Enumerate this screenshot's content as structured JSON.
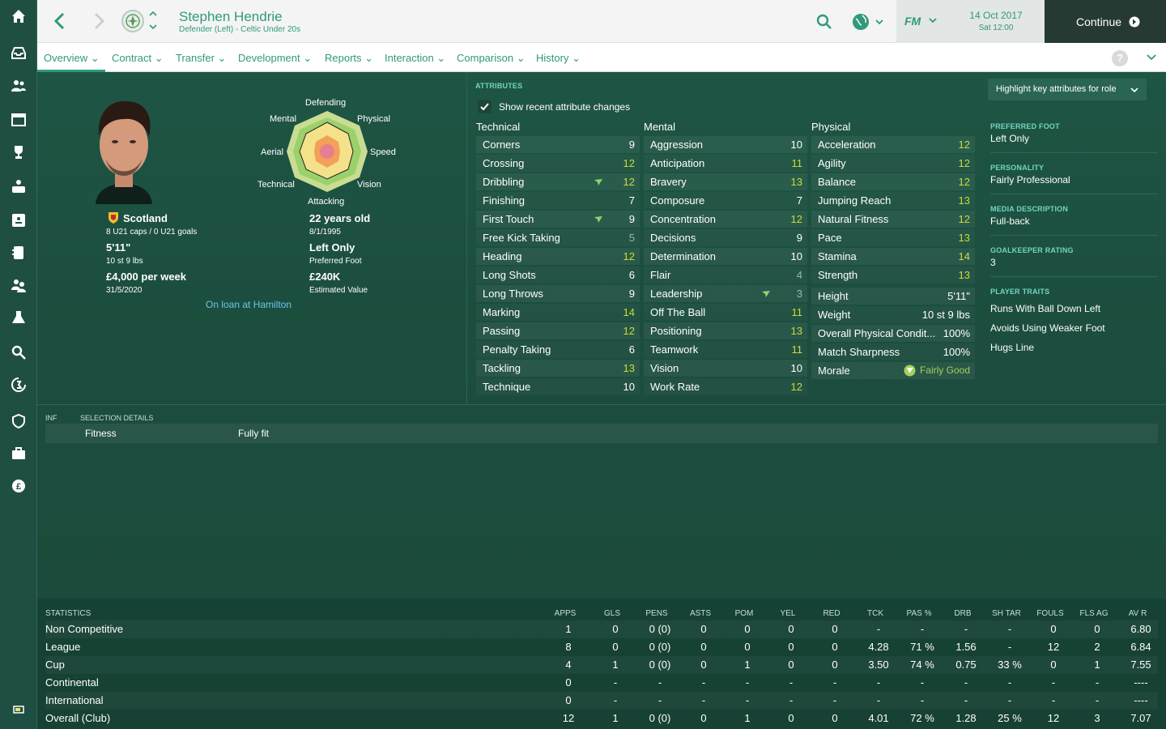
{
  "player": {
    "name": "Stephen Hendrie",
    "subtitle": "Defender (Left) - Celtic Under 20s"
  },
  "header": {
    "date": "14 Oct 2017",
    "time": "Sat 12:00",
    "fm_label": "FM",
    "continue_label": "Continue"
  },
  "tabs": [
    "Overview",
    "Contract",
    "Transfer",
    "Development",
    "Reports",
    "Interaction",
    "Comparison",
    "History"
  ],
  "radar": {
    "top": "Defending",
    "mental": "Mental",
    "physical": "Physical",
    "aerial": "Aerial",
    "speed": "Speed",
    "technical": "Technical",
    "vision": "Vision",
    "attacking": "Attacking"
  },
  "bio": {
    "nation": "Scotland",
    "caps": "8 U21 caps / 0 U21 goals",
    "height": "5'11\"",
    "weight": "10 st 9 lbs",
    "wage": "£4,000 per week",
    "contract_end": "31/5/2020",
    "age": "22 years old",
    "dob": "8/1/1995",
    "foot": "Left Only",
    "foot_label": "Preferred Foot",
    "value": "£240K",
    "value_label": "Estimated Value",
    "loan": "On loan at Hamilton"
  },
  "attributes": {
    "section_label": "ATTRIBUTES",
    "show_changes": "Show recent attribute changes",
    "highlight_dropdown": "Highlight key attributes for role",
    "technical_label": "Technical",
    "mental_label": "Mental",
    "physical_label": "Physical",
    "technical": [
      {
        "name": "Corners",
        "value": "9"
      },
      {
        "name": "Crossing",
        "value": "12"
      },
      {
        "name": "Dribbling",
        "value": "12"
      },
      {
        "name": "Finishing",
        "value": "7"
      },
      {
        "name": "First Touch",
        "value": "9"
      },
      {
        "name": "Free Kick Taking",
        "value": "5"
      },
      {
        "name": "Heading",
        "value": "12"
      },
      {
        "name": "Long Shots",
        "value": "6"
      },
      {
        "name": "Long Throws",
        "value": "9"
      },
      {
        "name": "Marking",
        "value": "14"
      },
      {
        "name": "Passing",
        "value": "12"
      },
      {
        "name": "Penalty Taking",
        "value": "6"
      },
      {
        "name": "Tackling",
        "value": "13"
      },
      {
        "name": "Technique",
        "value": "10"
      }
    ],
    "mental": [
      {
        "name": "Aggression",
        "value": "10"
      },
      {
        "name": "Anticipation",
        "value": "11"
      },
      {
        "name": "Bravery",
        "value": "13"
      },
      {
        "name": "Composure",
        "value": "7"
      },
      {
        "name": "Concentration",
        "value": "12"
      },
      {
        "name": "Decisions",
        "value": "9"
      },
      {
        "name": "Determination",
        "value": "10"
      },
      {
        "name": "Flair",
        "value": "4"
      },
      {
        "name": "Leadership",
        "value": "3"
      },
      {
        "name": "Off The Ball",
        "value": "11"
      },
      {
        "name": "Positioning",
        "value": "13"
      },
      {
        "name": "Teamwork",
        "value": "11"
      },
      {
        "name": "Vision",
        "value": "10"
      },
      {
        "name": "Work Rate",
        "value": "12"
      }
    ],
    "physical": [
      {
        "name": "Acceleration",
        "value": "12"
      },
      {
        "name": "Agility",
        "value": "12"
      },
      {
        "name": "Balance",
        "value": "12"
      },
      {
        "name": "Jumping Reach",
        "value": "13"
      },
      {
        "name": "Natural Fitness",
        "value": "12"
      },
      {
        "name": "Pace",
        "value": "13"
      },
      {
        "name": "Stamina",
        "value": "14"
      },
      {
        "name": "Strength",
        "value": "13"
      }
    ],
    "extra": [
      {
        "name": "Height",
        "value": "5'11\""
      },
      {
        "name": "Weight",
        "value": "10 st 9 lbs"
      },
      {
        "name": "Overall Physical Condit...",
        "value": "100%"
      },
      {
        "name": "Match Sharpness",
        "value": "100%"
      },
      {
        "name": "Morale",
        "value": "Fairly Good"
      }
    ]
  },
  "info": {
    "preferred_foot_label": "PREFERRED FOOT",
    "preferred_foot": "Left Only",
    "personality_label": "PERSONALITY",
    "personality": "Fairly Professional",
    "media_label": "MEDIA DESCRIPTION",
    "media": "Full-back",
    "gk_label": "GOALKEEPER RATING",
    "gk": "3",
    "traits_label": "PLAYER TRAITS",
    "traits": [
      "Runs With Ball Down Left",
      "Avoids Using Weaker Foot",
      "Hugs Line"
    ]
  },
  "selection": {
    "inf_label": "INF",
    "label": "SELECTION DETAILS",
    "fitness_label": "Fitness",
    "fitness_value": "Fully fit"
  },
  "statistics": {
    "label": "STATISTICS",
    "columns": [
      "APPS",
      "GLS",
      "PENS",
      "ASTS",
      "POM",
      "YEL",
      "RED",
      "TCK",
      "PAS %",
      "DRB",
      "SH TAR",
      "FOULS",
      "FLS AG",
      "AV R"
    ],
    "rows": [
      {
        "name": "Non Competitive",
        "cells": [
          "1",
          "0",
          "0 (0)",
          "0",
          "0",
          "0",
          "0",
          "-",
          "-",
          "-",
          "-",
          "0",
          "0",
          "6.80"
        ]
      },
      {
        "name": "League",
        "cells": [
          "8",
          "0",
          "0 (0)",
          "0",
          "0",
          "0",
          "0",
          "4.28",
          "71 %",
          "1.56",
          "-",
          "12",
          "2",
          "6.84"
        ]
      },
      {
        "name": "Cup",
        "cells": [
          "4",
          "1",
          "0 (0)",
          "0",
          "1",
          "0",
          "0",
          "3.50",
          "74 %",
          "0.75",
          "33 %",
          "0",
          "1",
          "7.55"
        ]
      },
      {
        "name": "Continental",
        "cells": [
          "0",
          "-",
          "-",
          "-",
          "-",
          "-",
          "-",
          "-",
          "-",
          "-",
          "-",
          "-",
          "-",
          "----"
        ]
      },
      {
        "name": "International",
        "cells": [
          "0",
          "-",
          "-",
          "-",
          "-",
          "-",
          "-",
          "-",
          "-",
          "-",
          "-",
          "-",
          "-",
          "----"
        ]
      },
      {
        "name": "Overall (Club)",
        "cells": [
          "12",
          "1",
          "0 (0)",
          "0",
          "1",
          "0",
          "0",
          "4.01",
          "72 %",
          "1.28",
          "25 %",
          "12",
          "3",
          "7.07"
        ]
      }
    ]
  }
}
